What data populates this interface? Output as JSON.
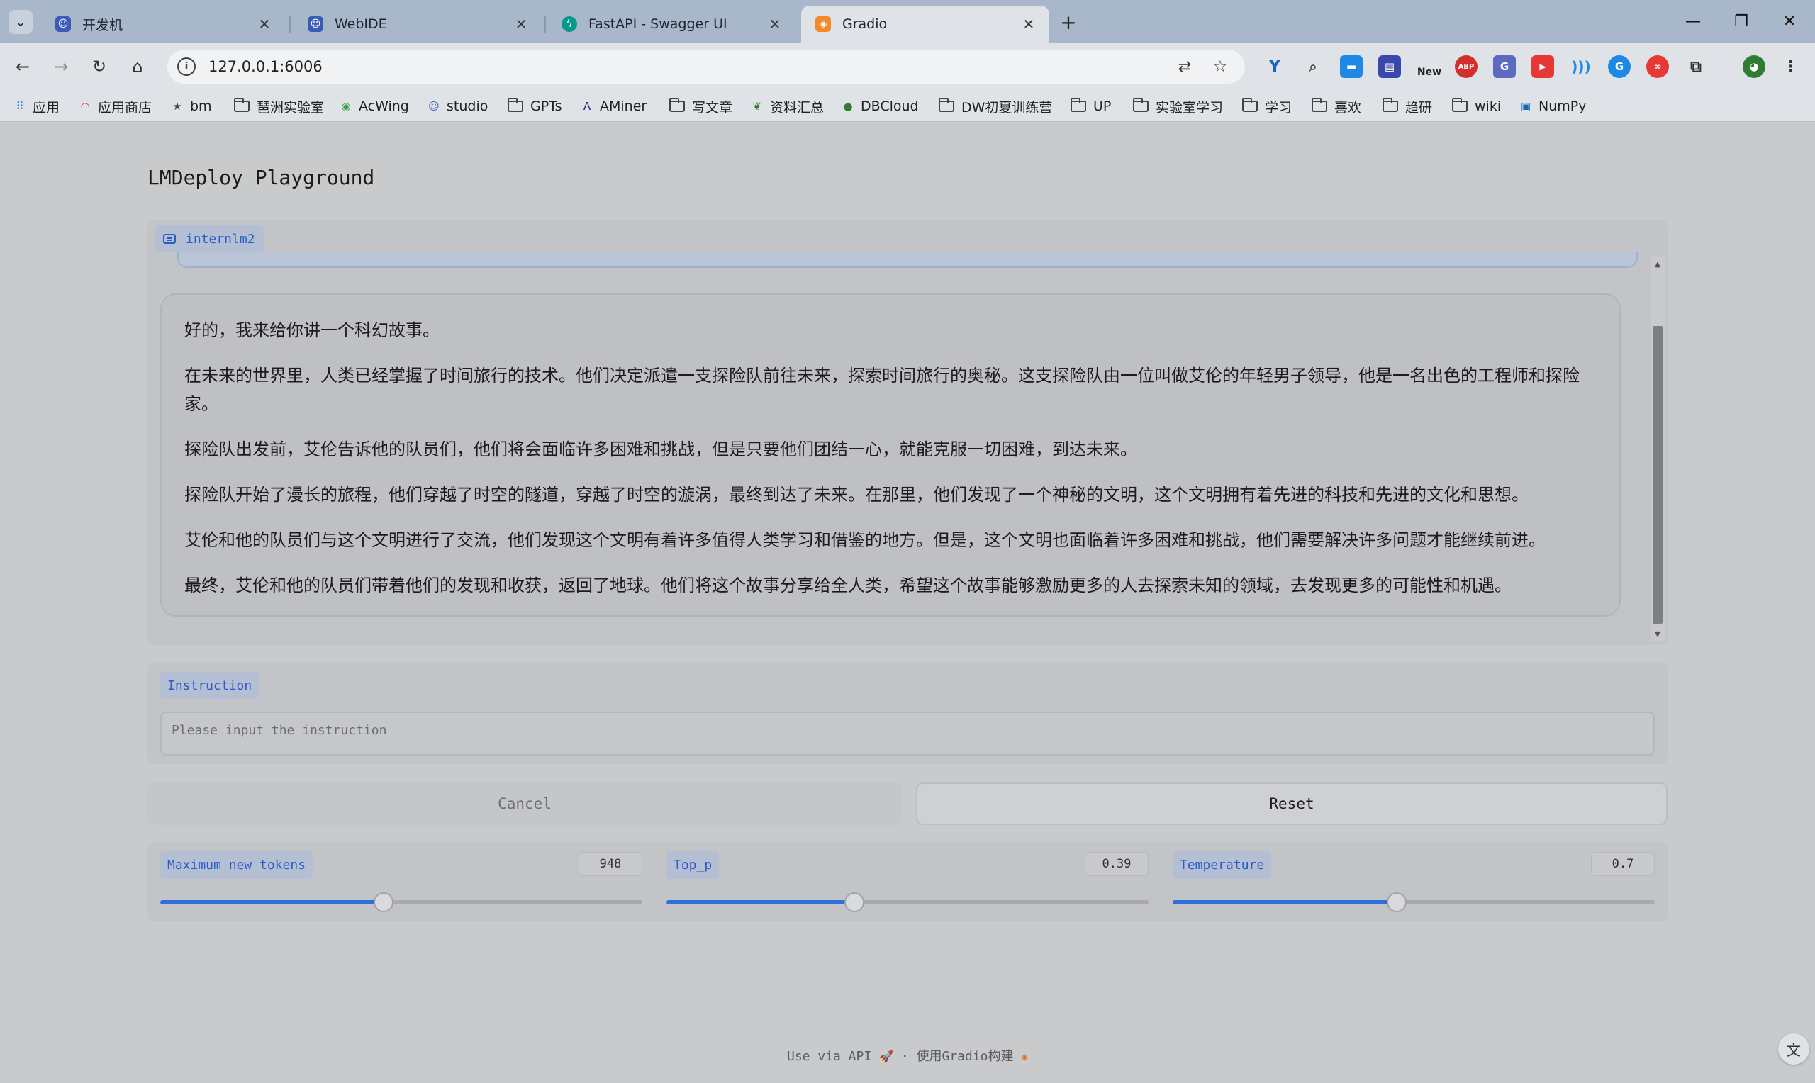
{
  "browser": {
    "tabs": [
      {
        "title": "开发机",
        "favicon": "robot-icon",
        "active": false
      },
      {
        "title": "WebIDE",
        "favicon": "robot-icon",
        "active": false
      },
      {
        "title": "FastAPI - Swagger UI",
        "favicon": "fastapi-icon",
        "active": false
      },
      {
        "title": "Gradio",
        "favicon": "gradio-icon",
        "active": true
      }
    ],
    "close_glyph": "✕",
    "url": "127.0.0.1:6006",
    "bookmarks": [
      {
        "label": "应用",
        "icon": "apps-grid-icon"
      },
      {
        "label": "应用商店",
        "icon": "rainbow-icon"
      },
      {
        "label": "bm",
        "icon": "star-icon"
      },
      {
        "label": "琶洲实验室",
        "icon": "folder-icon"
      },
      {
        "label": "AcWing",
        "icon": "acwing-icon"
      },
      {
        "label": "studio",
        "icon": "robot-icon"
      },
      {
        "label": "GPTs",
        "icon": "folder-icon"
      },
      {
        "label": "AMiner",
        "icon": "aminer-icon"
      },
      {
        "label": "写文章",
        "icon": "folder-icon"
      },
      {
        "label": "资料汇总",
        "icon": "leaf-icon"
      },
      {
        "label": "DBCloud",
        "icon": "dbcloud-icon"
      },
      {
        "label": "DW初夏训练营",
        "icon": "folder-icon"
      },
      {
        "label": "UP",
        "icon": "folder-icon"
      },
      {
        "label": "实验室学习",
        "icon": "folder-icon"
      },
      {
        "label": "学习",
        "icon": "folder-icon"
      },
      {
        "label": "喜欢",
        "icon": "folder-icon"
      },
      {
        "label": "趋研",
        "icon": "folder-icon"
      },
      {
        "label": "wiki",
        "icon": "folder-icon"
      },
      {
        "label": "NumPy",
        "icon": "numpy-icon"
      }
    ],
    "extension_badge": "New"
  },
  "app": {
    "title": "LMDeploy Playground",
    "chatbot_label": "internlm2",
    "assistant_message": [
      "好的，我来给你讲一个科幻故事。",
      "在未来的世界里，人类已经掌握了时间旅行的技术。他们决定派遣一支探险队前往未来，探索时间旅行的奥秘。这支探险队由一位叫做艾伦的年轻男子领导，他是一名出色的工程师和探险家。",
      "探险队出发前，艾伦告诉他的队员们，他们将会面临许多困难和挑战，但是只要他们团结一心，就能克服一切困难，到达未来。",
      "探险队开始了漫长的旅程，他们穿越了时空的隧道，穿越了时空的漩涡，最终到达了未来。在那里，他们发现了一个神秘的文明，这个文明拥有着先进的科技和先进的文化和思想。",
      "艾伦和他的队员们与这个文明进行了交流，他们发现这个文明有着许多值得人类学习和借鉴的地方。但是，这个文明也面临着许多困难和挑战，他们需要解决许多问题才能继续前进。",
      "最终，艾伦和他的队员们带着他们的发现和收获，返回了地球。他们将这个故事分享给全人类，希望这个故事能够激励更多的人去探索未知的领域，去发现更多的可能性和机遇。"
    ],
    "instruction": {
      "label": "Instruction",
      "placeholder": "Please input the instruction",
      "value": ""
    },
    "buttons": {
      "cancel": "Cancel",
      "reset": "Reset"
    },
    "sliders": [
      {
        "label": "Maximum new tokens",
        "value": "948",
        "fraction": 0.463
      },
      {
        "label": "Top_p",
        "value": "0.39",
        "fraction": 0.39
      },
      {
        "label": "Temperature",
        "value": "0.7",
        "fraction": 0.465
      }
    ],
    "footer": {
      "api_text": "Use via API",
      "separator": "·",
      "built_with": "使用Gradio构建"
    }
  },
  "colors": {
    "accent": "#2f6fdc",
    "label_text": "#2a5cc8",
    "label_bg": "#b4bfd3",
    "page_bg": "#c9cacc",
    "chrome_tabbar": "#a9b7cb"
  }
}
